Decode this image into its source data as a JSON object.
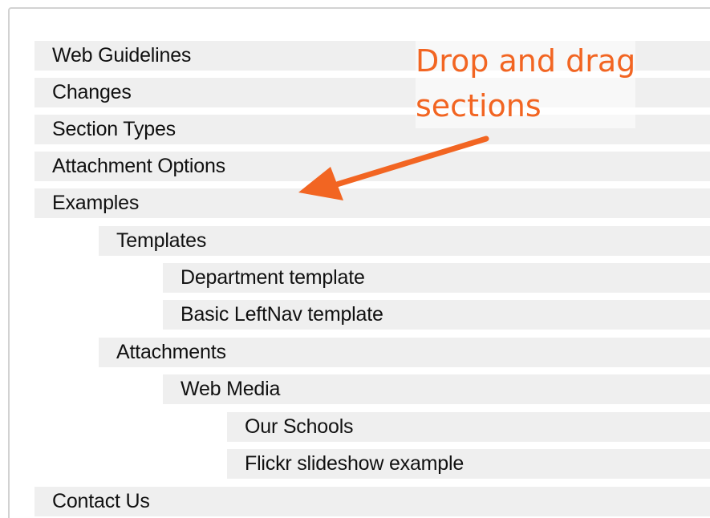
{
  "sections": [
    {
      "label": "Web Guidelines",
      "depth": 0
    },
    {
      "label": "Changes",
      "depth": 0
    },
    {
      "label": "Section Types",
      "depth": 0
    },
    {
      "label": "Attachment Options",
      "depth": 0
    },
    {
      "label": "Examples",
      "depth": 0
    },
    {
      "label": "Templates",
      "depth": 1
    },
    {
      "label": "Department template",
      "depth": 2
    },
    {
      "label": "Basic LeftNav template",
      "depth": 2
    },
    {
      "label": "Attachments",
      "depth": 1
    },
    {
      "label": "Web Media",
      "depth": 2
    },
    {
      "label": "Our Schools",
      "depth": 3
    },
    {
      "label": "Flickr slideshow example",
      "depth": 3
    },
    {
      "label": "Contact Us",
      "depth": 0
    }
  ],
  "annotation": {
    "line1": "Drop and drag",
    "line2": "sections",
    "color": "#f26522",
    "arrow_icon": "arrow-icon"
  },
  "colors": {
    "row_background": "#efefef",
    "panel_border": "#d2d2d2"
  }
}
